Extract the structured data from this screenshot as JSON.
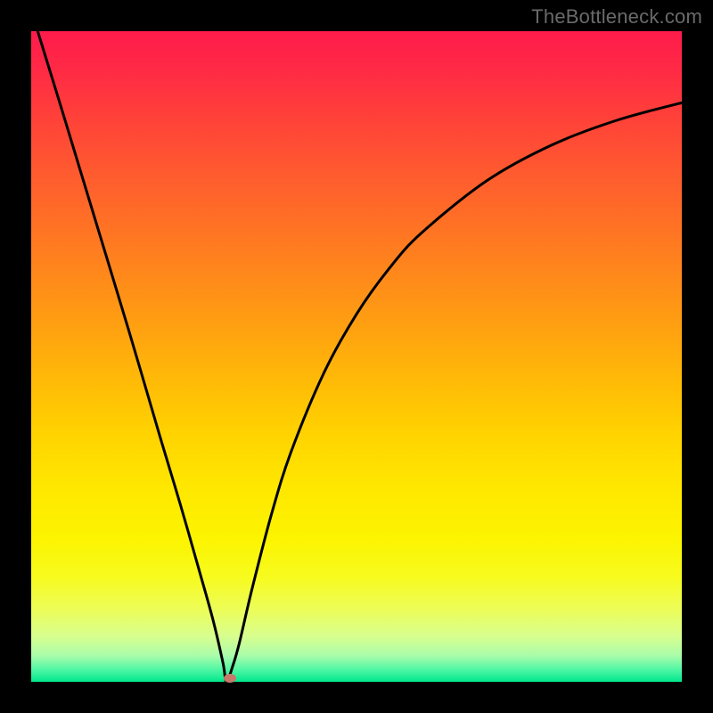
{
  "watermark": "TheBottleneck.com",
  "chart_data": {
    "type": "line",
    "title": "",
    "xlabel": "",
    "ylabel": "",
    "xlim": [
      0,
      1
    ],
    "ylim": [
      0,
      1
    ],
    "series": [
      {
        "name": "bottleneck-curve",
        "x": [
          0.01,
          0.05,
          0.1,
          0.15,
          0.2,
          0.23,
          0.26,
          0.28,
          0.295,
          0.3,
          0.31,
          0.32,
          0.34,
          0.37,
          0.4,
          0.45,
          0.5,
          0.55,
          0.6,
          0.7,
          0.8,
          0.9,
          1.0
        ],
        "values": [
          1.0,
          0.87,
          0.705,
          0.54,
          0.37,
          0.27,
          0.165,
          0.093,
          0.028,
          0.0,
          0.025,
          0.06,
          0.145,
          0.26,
          0.355,
          0.475,
          0.565,
          0.635,
          0.69,
          0.77,
          0.825,
          0.863,
          0.89
        ]
      }
    ],
    "marker": {
      "x": 0.305,
      "y": 0.005,
      "color": "#c77a6b"
    },
    "background_gradient": {
      "top": "#ff1b4b",
      "mid": "#ffd300",
      "bottom": "#00e88d"
    }
  }
}
